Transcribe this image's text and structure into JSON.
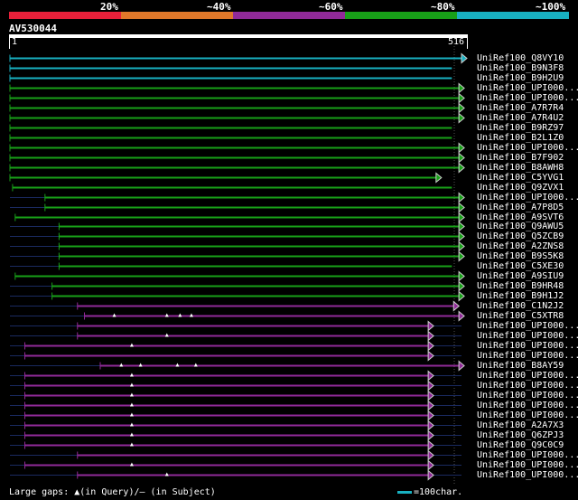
{
  "legend": {
    "labels": [
      "20%",
      "~40%",
      "~60%",
      "~80%",
      "~100%"
    ],
    "colors": [
      "#e8203a",
      "#e0782a",
      "#902a98",
      "#18a018",
      "#18b0c0"
    ]
  },
  "query": {
    "name": "AV530044",
    "start": "1",
    "end": "516"
  },
  "hits": [
    {
      "label": "UniRef100_Q8VY10",
      "color": "#18b0c0",
      "start": 1,
      "end": 516,
      "arrow": "#cccccc",
      "dim": [],
      "gaps": []
    },
    {
      "label": "UniRef100_B9N3F8",
      "color": "#18b0c0",
      "start": 1,
      "end": 505,
      "arrow": null,
      "dim": [],
      "gaps": []
    },
    {
      "label": "UniRef100_B9H2U9",
      "color": "#18b0c0",
      "start": 1,
      "end": 505,
      "arrow": null,
      "dim": [],
      "gaps": []
    },
    {
      "label": "UniRef100_UPI000...",
      "color": "#18a018",
      "start": 1,
      "end": 513,
      "arrow": "#cccccc",
      "dim": [],
      "gaps": []
    },
    {
      "label": "UniRef100_UPI000...",
      "color": "#18a018",
      "start": 1,
      "end": 513,
      "arrow": "#cccccc",
      "dim": [],
      "gaps": []
    },
    {
      "label": "UniRef100_A7R7R4",
      "color": "#18a018",
      "start": 1,
      "end": 513,
      "arrow": "#cccccc",
      "dim": [],
      "gaps": []
    },
    {
      "label": "UniRef100_A7R4U2",
      "color": "#18a018",
      "start": 1,
      "end": 513,
      "arrow": "#cccccc",
      "dim": [],
      "gaps": []
    },
    {
      "label": "UniRef100_B9RZ97",
      "color": "#18a018",
      "start": 1,
      "end": 505,
      "arrow": null,
      "dim": [],
      "gaps": []
    },
    {
      "label": "UniRef100_B2L1Z0",
      "color": "#18a018",
      "start": 1,
      "end": 505,
      "arrow": null,
      "dim": [],
      "gaps": []
    },
    {
      "label": "UniRef100_UPI000...",
      "color": "#18a018",
      "start": 1,
      "end": 513,
      "arrow": "#cccccc",
      "dim": [],
      "gaps": []
    },
    {
      "label": "UniRef100_B7F902",
      "color": "#18a018",
      "start": 1,
      "end": 513,
      "arrow": "#cccccc",
      "dim": [],
      "gaps": []
    },
    {
      "label": "UniRef100_B8AWH8",
      "color": "#18a018",
      "start": 1,
      "end": 513,
      "arrow": "#cccccc",
      "dim": [],
      "gaps": []
    },
    {
      "label": "UniRef100_C5YVG1",
      "color": "#18a018",
      "start": 1,
      "end": 487,
      "arrow": "#cccccc",
      "dim": [],
      "gaps": []
    },
    {
      "label": "UniRef100_Q9ZVX1",
      "color": "#18a018",
      "start": 4,
      "end": 505,
      "arrow": null,
      "dim": [],
      "gaps": []
    },
    {
      "label": "UniRef100_UPI000...",
      "color": "#18a018",
      "start": 41,
      "end": 513,
      "arrow": "#cccccc",
      "dim": [
        [
          1,
          41
        ]
      ],
      "gaps": []
    },
    {
      "label": "UniRef100_A7P8D5",
      "color": "#18a018",
      "start": 41,
      "end": 513,
      "arrow": "#cccccc",
      "dim": [
        [
          1,
          41
        ]
      ],
      "gaps": []
    },
    {
      "label": "UniRef100_A9SVT6",
      "color": "#18a018",
      "start": 7,
      "end": 513,
      "arrow": "#cccccc",
      "dim": [
        [
          7,
          38
        ]
      ],
      "gaps": []
    },
    {
      "label": "UniRef100_Q9AWU5",
      "color": "#18a018",
      "start": 57,
      "end": 513,
      "arrow": "#cccccc",
      "dim": [
        [
          1,
          57
        ]
      ],
      "gaps": []
    },
    {
      "label": "UniRef100_Q5ZCB9",
      "color": "#18a018",
      "start": 57,
      "end": 513,
      "arrow": "#cccccc",
      "dim": [
        [
          1,
          57
        ]
      ],
      "gaps": []
    },
    {
      "label": "UniRef100_A2ZNS8",
      "color": "#18a018",
      "start": 57,
      "end": 513,
      "arrow": "#cccccc",
      "dim": [
        [
          1,
          57
        ]
      ],
      "gaps": []
    },
    {
      "label": "UniRef100_B9S5K8",
      "color": "#18a018",
      "start": 57,
      "end": 513,
      "arrow": "#cccccc",
      "dim": [
        [
          1,
          57
        ]
      ],
      "gaps": []
    },
    {
      "label": "UniRef100_C5XE30",
      "color": "#18a018",
      "start": 57,
      "end": 505,
      "arrow": null,
      "dim": [
        [
          1,
          57
        ]
      ],
      "gaps": []
    },
    {
      "label": "UniRef100_A9SIU9",
      "color": "#18a018",
      "start": 7,
      "end": 513,
      "arrow": "#cccccc",
      "dim": [
        [
          7,
          70
        ]
      ],
      "gaps": []
    },
    {
      "label": "UniRef100_B9HR48",
      "color": "#18a018",
      "start": 49,
      "end": 513,
      "arrow": "#cccccc",
      "dim": [
        [
          1,
          49
        ]
      ],
      "gaps": []
    },
    {
      "label": "UniRef100_B9H1J2",
      "color": "#18a018",
      "start": 49,
      "end": 513,
      "arrow": "#cccccc",
      "dim": [
        [
          1,
          49
        ]
      ],
      "gaps": []
    },
    {
      "label": "UniRef100_C1N2J2",
      "color": "#902a98",
      "start": 78,
      "end": 507,
      "arrow": "#cccccc",
      "dim": [
        [
          1,
          78
        ]
      ],
      "gaps": []
    },
    {
      "label": "UniRef100_C5XTR8",
      "color": "#902a98",
      "start": 86,
      "end": 513,
      "arrow": "#cccccc",
      "dim": [
        [
          1,
          86
        ]
      ],
      "gaps": [
        120,
        180,
        195,
        208
      ]
    },
    {
      "label": "UniRef100_UPI000...",
      "color": "#902a98",
      "start": 78,
      "end": 478,
      "arrow": "#cccccc",
      "dim": [
        [
          1,
          78
        ],
        [
          478,
          516
        ]
      ],
      "gaps": []
    },
    {
      "label": "UniRef100_UPI000...",
      "color": "#902a98",
      "start": 78,
      "end": 478,
      "arrow": "#cccccc",
      "dim": [
        [
          1,
          78
        ],
        [
          478,
          516
        ]
      ],
      "gaps": [
        180
      ]
    },
    {
      "label": "UniRef100_UPI000...",
      "color": "#902a98",
      "start": 18,
      "end": 478,
      "arrow": "#cccccc",
      "dim": [
        [
          1,
          18
        ],
        [
          478,
          516
        ]
      ],
      "gaps": [
        140
      ]
    },
    {
      "label": "UniRef100_UPI000...",
      "color": "#902a98",
      "start": 18,
      "end": 478,
      "arrow": "#cccccc",
      "dim": [
        [
          1,
          18
        ],
        [
          478,
          516
        ]
      ],
      "gaps": []
    },
    {
      "label": "UniRef100_B8AY59",
      "color": "#902a98",
      "start": 104,
      "end": 513,
      "arrow": "#cccccc",
      "dim": [
        [
          1,
          104
        ]
      ],
      "gaps": [
        128,
        150,
        192,
        213
      ]
    },
    {
      "label": "UniRef100_UPI000...",
      "color": "#902a98",
      "start": 18,
      "end": 478,
      "arrow": "#cccccc",
      "dim": [
        [
          1,
          18
        ],
        [
          478,
          516
        ]
      ],
      "gaps": [
        140
      ]
    },
    {
      "label": "UniRef100_UPI000...",
      "color": "#902a98",
      "start": 18,
      "end": 478,
      "arrow": "#cccccc",
      "dim": [
        [
          1,
          18
        ],
        [
          478,
          516
        ]
      ],
      "gaps": [
        140
      ]
    },
    {
      "label": "UniRef100_UPI000...",
      "color": "#902a98",
      "start": 18,
      "end": 478,
      "arrow": "#cccccc",
      "dim": [
        [
          1,
          18
        ],
        [
          478,
          516
        ]
      ],
      "gaps": [
        140
      ]
    },
    {
      "label": "UniRef100_UPI000...",
      "color": "#902a98",
      "start": 18,
      "end": 478,
      "arrow": "#cccccc",
      "dim": [
        [
          1,
          18
        ],
        [
          478,
          516
        ]
      ],
      "gaps": [
        140
      ]
    },
    {
      "label": "UniRef100_UPI000...",
      "color": "#902a98",
      "start": 18,
      "end": 478,
      "arrow": "#cccccc",
      "dim": [
        [
          1,
          18
        ],
        [
          478,
          516
        ]
      ],
      "gaps": [
        140
      ]
    },
    {
      "label": "UniRef100_A2A7X3",
      "color": "#902a98",
      "start": 18,
      "end": 478,
      "arrow": "#cccccc",
      "dim": [
        [
          1,
          18
        ],
        [
          478,
          516
        ]
      ],
      "gaps": [
        140
      ]
    },
    {
      "label": "UniRef100_Q6ZPJ3",
      "color": "#902a98",
      "start": 18,
      "end": 478,
      "arrow": "#cccccc",
      "dim": [
        [
          1,
          18
        ],
        [
          478,
          516
        ]
      ],
      "gaps": [
        140
      ]
    },
    {
      "label": "UniRef100_Q9C0C9",
      "color": "#902a98",
      "start": 18,
      "end": 478,
      "arrow": "#cccccc",
      "dim": [
        [
          1,
          18
        ],
        [
          478,
          516
        ]
      ],
      "gaps": [
        140
      ]
    },
    {
      "label": "UniRef100_UPI000...",
      "color": "#902a98",
      "start": 78,
      "end": 478,
      "arrow": "#cccccc",
      "dim": [
        [
          1,
          78
        ],
        [
          478,
          516
        ]
      ],
      "gaps": []
    },
    {
      "label": "UniRef100_UPI000...",
      "color": "#902a98",
      "start": 18,
      "end": 478,
      "arrow": "#cccccc",
      "dim": [
        [
          1,
          18
        ],
        [
          478,
          516
        ]
      ],
      "gaps": [
        140
      ]
    },
    {
      "label": "UniRef100_UPI000...",
      "color": "#902a98",
      "start": 78,
      "end": 478,
      "arrow": "#cccccc",
      "dim": [
        [
          1,
          78
        ],
        [
          478,
          516
        ]
      ],
      "gaps": [
        180
      ]
    }
  ],
  "footer": {
    "gaps_text": "Large gaps: ▲(in Query)/– (in Subject)",
    "scale_text": "=100char.",
    "scale_color": "#18b0c0"
  }
}
